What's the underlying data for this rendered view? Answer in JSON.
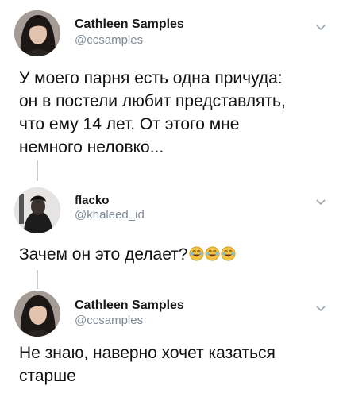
{
  "tweets": [
    {
      "name": "Cathleen Samples",
      "handle": "@ccsamples",
      "lines": [
        "У моего парня есть одна причуда:",
        "он в постели любит представлять,",
        "что ему 14 лет. От этого мне",
        "немного неловко..."
      ],
      "avatar_icon": "woman-portrait-avatar",
      "menu_icon": "chevron-down-icon"
    },
    {
      "name": "flacko",
      "handle": "@khaleed_id",
      "lines": [
        "Зачем он это делает?"
      ],
      "emoji": [
        "😂",
        "😂",
        "😂"
      ],
      "avatar_icon": "man-portrait-avatar",
      "menu_icon": "chevron-down-icon"
    },
    {
      "name": "Cathleen Samples",
      "handle": "@ccsamples",
      "lines": [
        "Не знаю, наверно хочет казаться",
        "старше"
      ],
      "avatar_icon": "woman-portrait-avatar",
      "menu_icon": "chevron-down-icon"
    }
  ],
  "colors": {
    "handle": "#7d8a96",
    "thread_line": "#c9ccd0",
    "emoji_face": "#f5c243"
  }
}
